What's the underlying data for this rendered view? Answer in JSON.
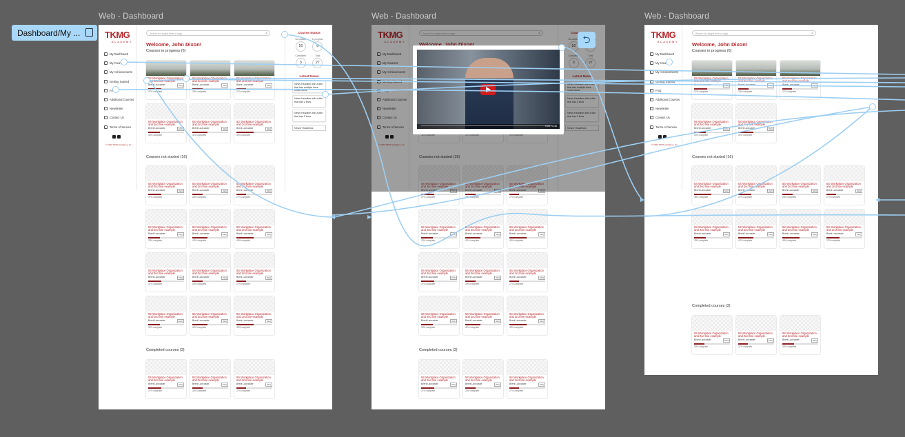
{
  "frames": [
    {
      "label": "Web - Dashboard"
    },
    {
      "label": "Web - Dashboard"
    },
    {
      "label": "Web - Dashboard"
    }
  ],
  "prototype_label": "Dashboard/My ...",
  "logo": {
    "line1": "TKMG",
    "line2": "ACADEMY"
  },
  "nav": [
    "My Dashboard",
    "My Courses",
    "My Achievements",
    "Getting Started",
    "FAQ",
    "Additional Courses",
    "Newsletter",
    "Contact Us",
    "Terms of Service"
  ],
  "footer": {
    "copyright": "© 2023 TKMG Academy, Inc."
  },
  "search": {
    "placeholder": "Search for single term or tags"
  },
  "welcome": "Welcome, John Dixon!",
  "sections": {
    "in_progress": "Courses in progress (6)",
    "not_started": "Courses not started (16)",
    "completed": "Completed courses (3)"
  },
  "course_card": {
    "title": "5S Workplace Organization and 2nd line example",
    "author": "Brent Lancaster",
    "badge": "REQ"
  },
  "progress_values": [
    "37% complete",
    "28% complete",
    "27% complete",
    "33% complete",
    "42% complete",
    "49% complete"
  ],
  "course_status": {
    "title": "Course Status",
    "items": [
      {
        "label": "Not started",
        "value": "16"
      },
      {
        "label": "In progress",
        "value": "6"
      },
      {
        "label": "Completed",
        "value": "3"
      },
      {
        "label": "Total",
        "value": "27"
      }
    ]
  },
  "latest_news": {
    "title": "Latest News",
    "items": [
      "News Headline with a title that has multiple lines show cards",
      "News Headline with a title that has 2 lines",
      "News Headline with a title that has 2 lines"
    ],
    "button": "Newer Headlines"
  },
  "video": {
    "time": "0:00 / 0:46"
  },
  "colors": {
    "accent": "#b5262b",
    "link": "#9dcff3",
    "canvas": "#5f5f5f"
  }
}
